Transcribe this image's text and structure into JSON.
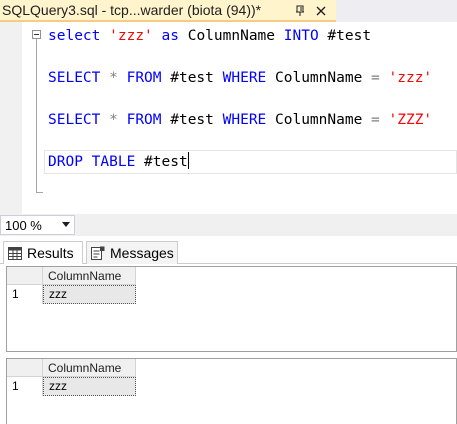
{
  "tab": {
    "title": "SQLQuery3.sql - tcp...warder (biota (94))*",
    "pin_icon": "pin-icon",
    "close_icon": "close-icon"
  },
  "editor": {
    "lines": [
      {
        "tokens": [
          {
            "t": "select",
            "k": "kw"
          },
          {
            "t": " ",
            "k": "id"
          },
          {
            "t": "'zzz'",
            "k": "str"
          },
          {
            "t": " ",
            "k": "id"
          },
          {
            "t": "as",
            "k": "kw"
          },
          {
            "t": " ColumnName ",
            "k": "id"
          },
          {
            "t": "INTO",
            "k": "kw"
          },
          {
            "t": " #test",
            "k": "id"
          }
        ]
      },
      {
        "tokens": [
          {
            "t": "SELECT",
            "k": "kw"
          },
          {
            "t": " ",
            "k": "id"
          },
          {
            "t": "*",
            "k": "op"
          },
          {
            "t": " ",
            "k": "id"
          },
          {
            "t": "FROM",
            "k": "kw"
          },
          {
            "t": " #test ",
            "k": "id"
          },
          {
            "t": "WHERE",
            "k": "kw"
          },
          {
            "t": " ColumnName ",
            "k": "id"
          },
          {
            "t": "=",
            "k": "op"
          },
          {
            "t": " ",
            "k": "id"
          },
          {
            "t": "'zzz'",
            "k": "str"
          }
        ]
      },
      {
        "tokens": [
          {
            "t": "SELECT",
            "k": "kw"
          },
          {
            "t": " ",
            "k": "id"
          },
          {
            "t": "*",
            "k": "op"
          },
          {
            "t": " ",
            "k": "id"
          },
          {
            "t": "FROM",
            "k": "kw"
          },
          {
            "t": " #test ",
            "k": "id"
          },
          {
            "t": "WHERE",
            "k": "kw"
          },
          {
            "t": " ColumnName ",
            "k": "id"
          },
          {
            "t": "=",
            "k": "op"
          },
          {
            "t": " ",
            "k": "id"
          },
          {
            "t": "'ZZZ'",
            "k": "str"
          }
        ]
      },
      {
        "tokens": [
          {
            "t": "DROP",
            "k": "kw"
          },
          {
            "t": " ",
            "k": "id"
          },
          {
            "t": "TABLE",
            "k": "kw"
          },
          {
            "t": " #test",
            "k": "id"
          }
        ]
      }
    ]
  },
  "zoom": {
    "value": "100 %",
    "arrow_icon": "chevron-down-icon"
  },
  "result_tabs": {
    "results_label": "Results",
    "messages_label": "Messages",
    "results_icon": "grid-icon",
    "messages_icon": "messages-icon"
  },
  "grids": [
    {
      "column_header": "ColumnName",
      "rows": [
        {
          "num": "1",
          "value": "zzz"
        }
      ]
    },
    {
      "column_header": "ColumnName",
      "rows": [
        {
          "num": "1",
          "value": "zzz"
        }
      ]
    }
  ],
  "colors": {
    "keyword": "#0000ff",
    "string": "#ff0000",
    "operator": "#808080",
    "active_tab": "#fff4cc"
  }
}
